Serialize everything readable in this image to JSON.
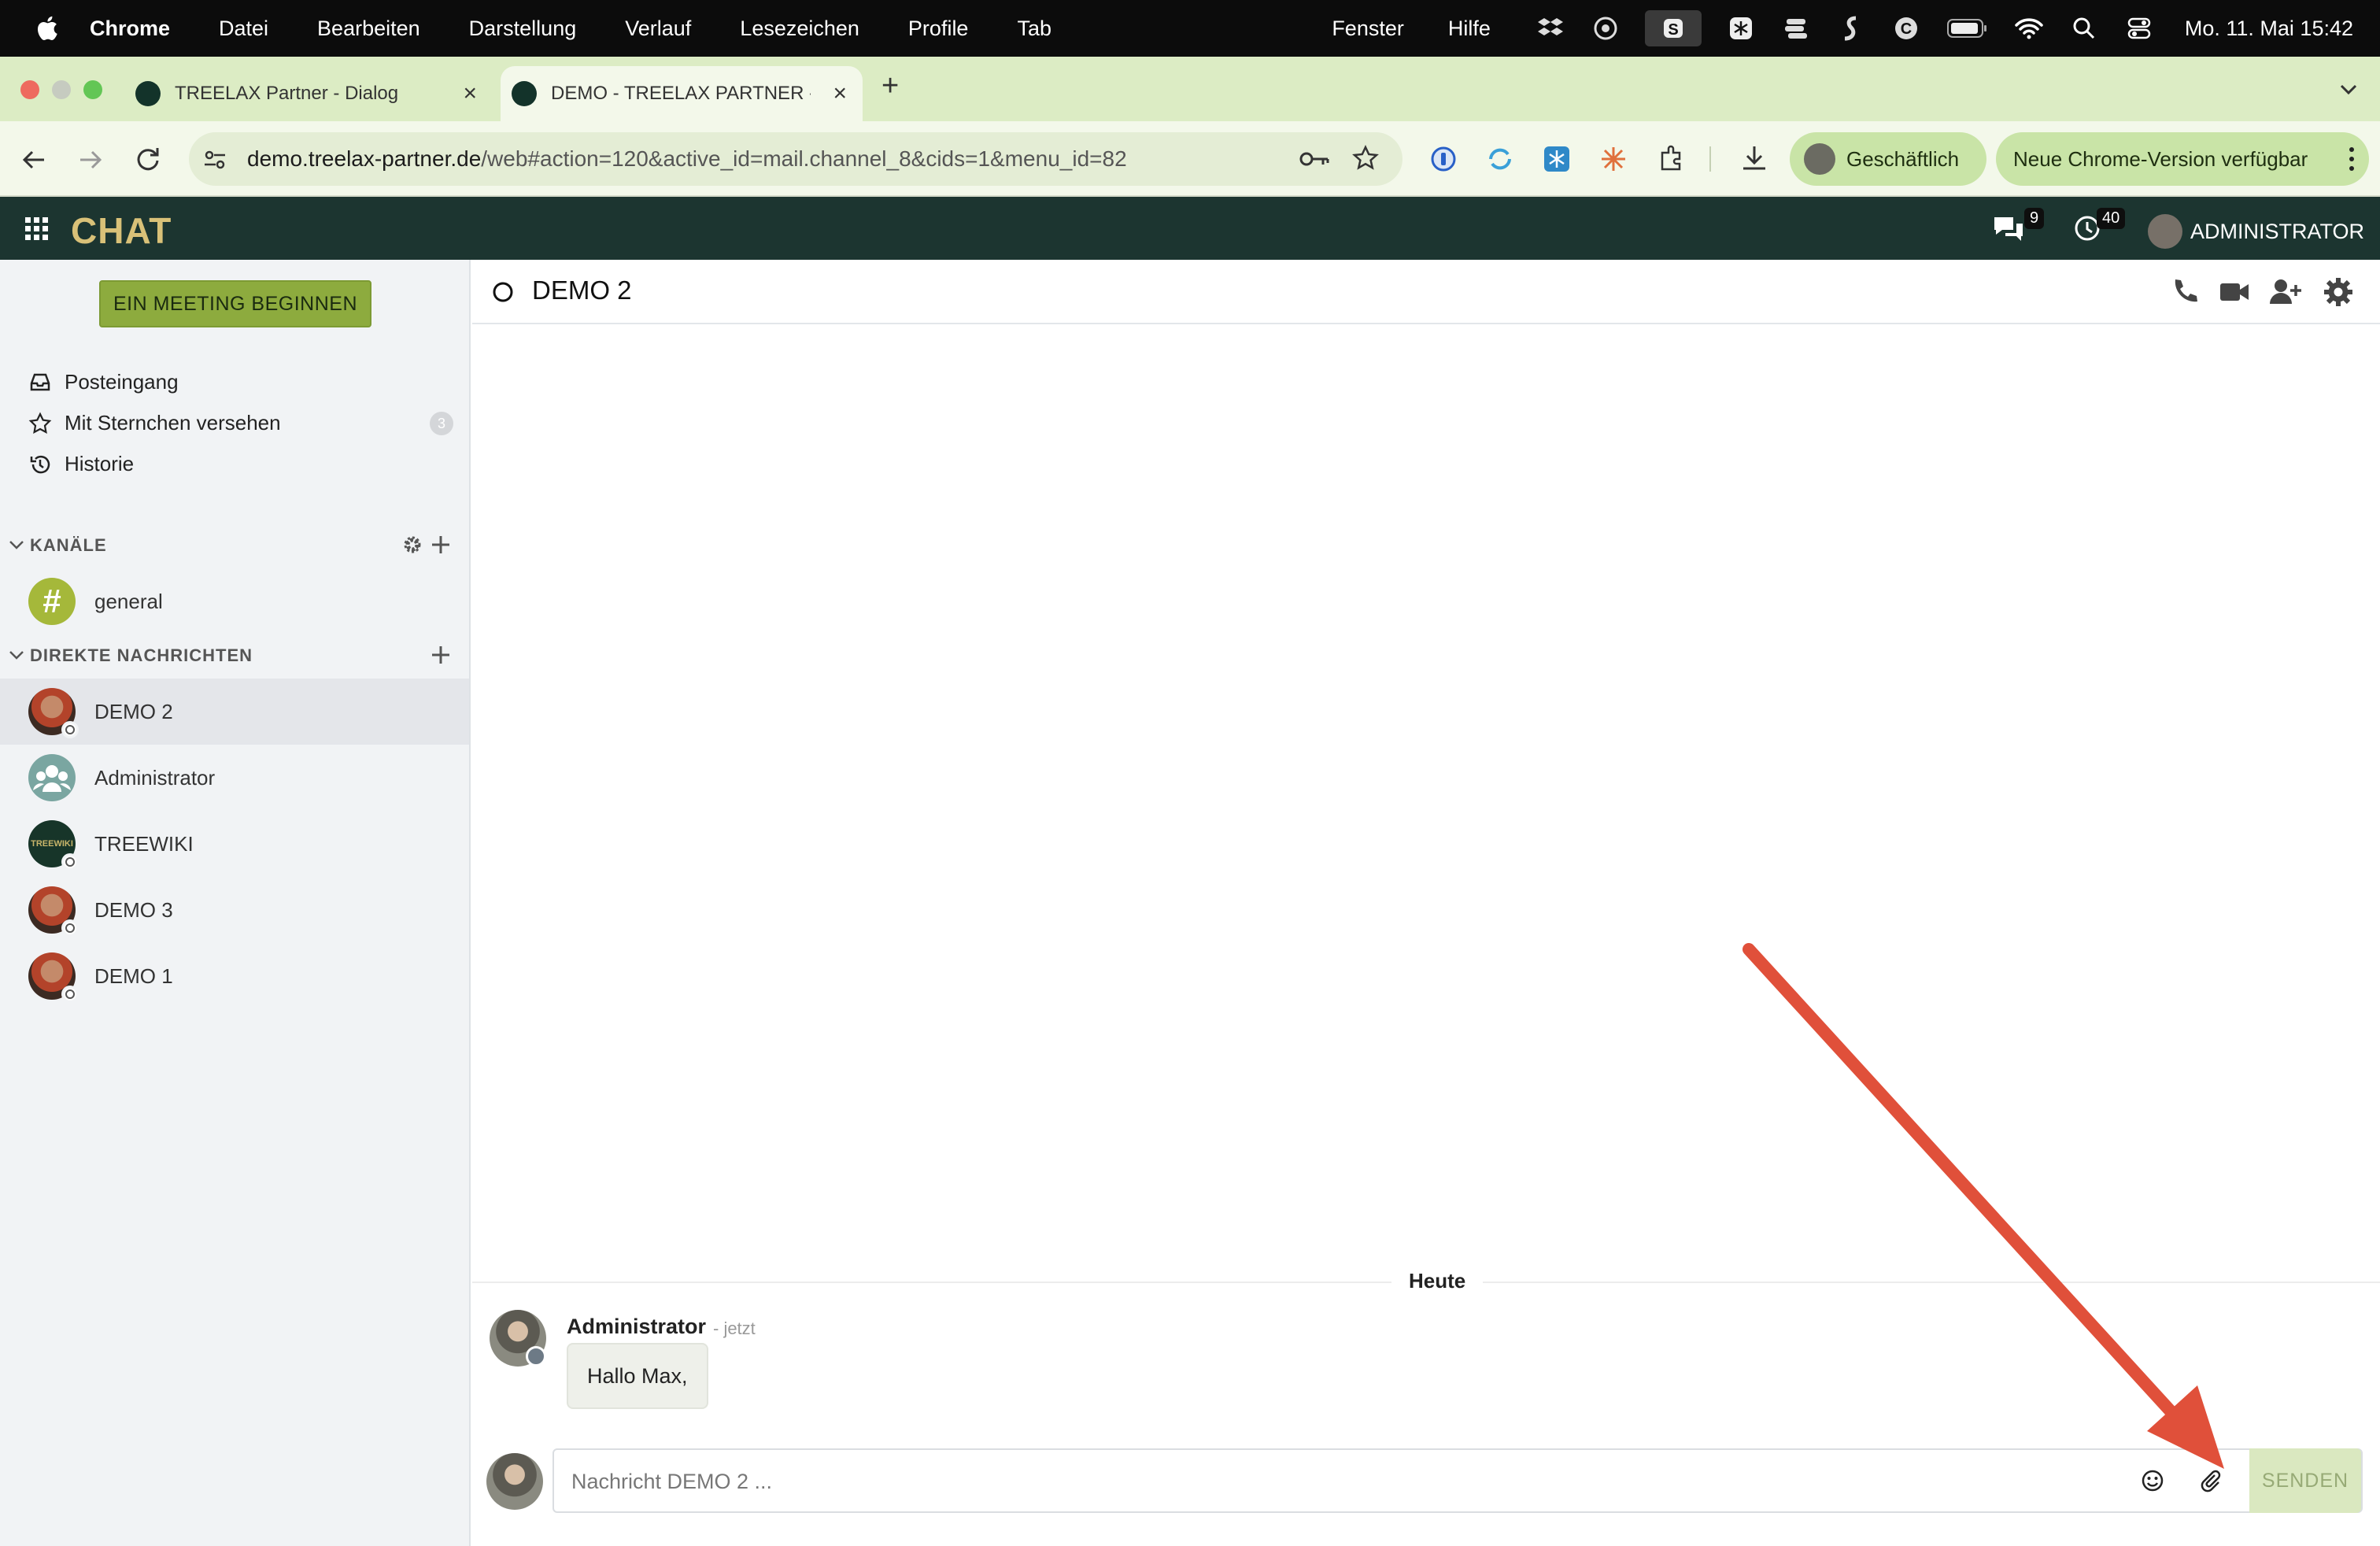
{
  "menubar": {
    "app": "Chrome",
    "items": [
      "Datei",
      "Bearbeiten",
      "Darstellung",
      "Verlauf",
      "Lesezeichen",
      "Profile",
      "Tab"
    ],
    "right_items": [
      "Fenster",
      "Hilfe"
    ],
    "clock": "Mo. 11. Mai  15:42"
  },
  "browser": {
    "tabs": [
      {
        "title": "TREELAX Partner - Dialog"
      },
      {
        "title": "DEMO - TREELAX PARTNER -"
      }
    ],
    "url_host": "demo.treelax-partner.de",
    "url_path": "/web#action=120&active_id=mail.channel_8&cids=1&menu_id=82",
    "profile_label": "Geschäftlich",
    "update_label": "Neue Chrome-Version verfügbar"
  },
  "app": {
    "title": "CHAT",
    "chat_badge": "9",
    "activity_badge": "40",
    "user": "ADMINISTRATOR"
  },
  "sidebar": {
    "meeting_button": "EIN MEETING BEGINNEN",
    "nav": [
      {
        "label": "Posteingang",
        "icon": "inbox-icon"
      },
      {
        "label": "Mit Sternchen versehen",
        "icon": "star-icon",
        "count": "3"
      },
      {
        "label": "Historie",
        "icon": "history-icon"
      }
    ],
    "channels_header": "KANÄLE",
    "channels": [
      {
        "name": "general"
      }
    ],
    "dm_header": "DIREKTE NACHRICHTEN",
    "dms": [
      {
        "name": "DEMO 2"
      },
      {
        "name": "Administrator"
      },
      {
        "name": "TREEWIKI"
      },
      {
        "name": "DEMO 3"
      },
      {
        "name": "DEMO 1"
      }
    ]
  },
  "thread": {
    "name": "DEMO 2",
    "day_separator": "Heute",
    "message": {
      "author": "Administrator",
      "time": "- jetzt",
      "text": "Hallo Max,"
    },
    "composer_placeholder": "Nachricht DEMO 2 ...",
    "send_label": "SENDEN"
  },
  "colors": {
    "header_bg": "#1c3530",
    "brand_gold": "#d9c178",
    "meeting_green": "#8dab3e",
    "annotation_arrow": "#e0503a"
  }
}
